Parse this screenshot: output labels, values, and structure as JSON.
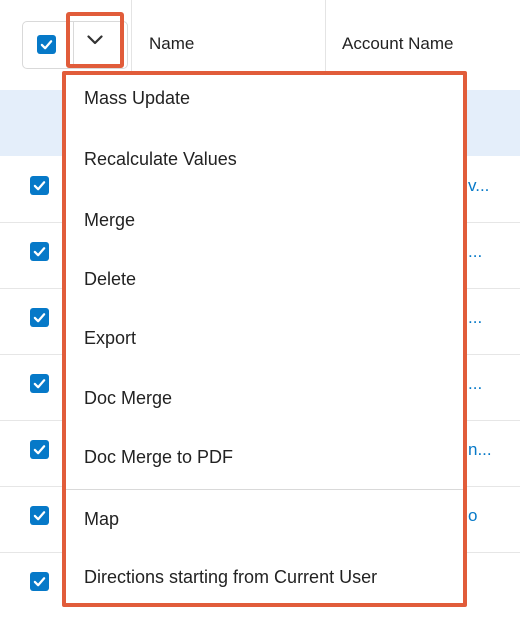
{
  "table": {
    "columns": {
      "name": "Name",
      "account_name": "Account Name"
    },
    "rows": [
      {
        "link": "v..."
      },
      {
        "link": "..."
      },
      {
        "link": "..."
      },
      {
        "link": "..."
      },
      {
        "link": "n..."
      },
      {
        "link": "o"
      },
      {
        "link": ""
      }
    ]
  },
  "menu": {
    "items": [
      "Mass Update",
      "Recalculate Values",
      "Merge",
      "Delete",
      "Export",
      "Doc Merge",
      "Doc Merge to PDF",
      "Map",
      "Directions starting from Current User"
    ]
  },
  "colors": {
    "accent": "#0679c8",
    "highlight": "#e15c3a",
    "selected_row": "#e4eefa"
  },
  "icons": {
    "select_all": "checkbox-checked-icon",
    "actions": "chevron-down-icon"
  }
}
